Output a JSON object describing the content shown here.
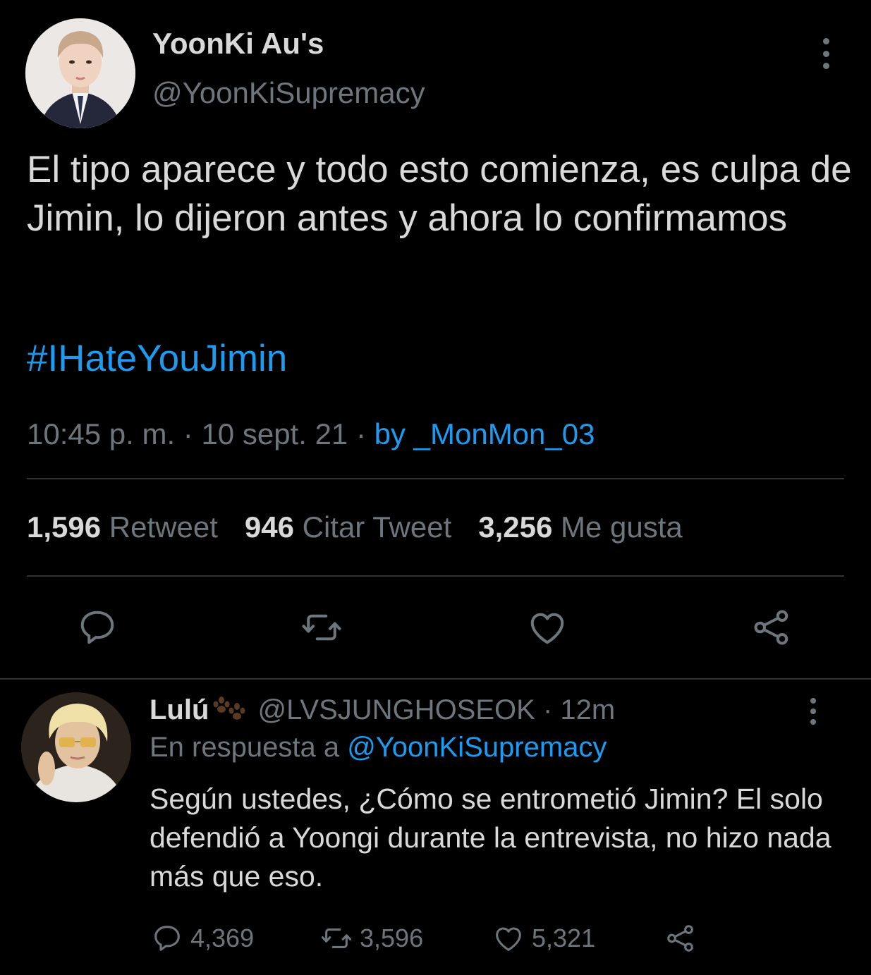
{
  "tweet": {
    "author_name": "YoonKi Au's",
    "author_handle": "@YoonKiSupremacy",
    "text": "El tipo aparece y todo esto comienza, es culpa de Jimin, lo dijeron antes y ahora lo confirmamos",
    "hashtag": "#IHateYouJimin",
    "time": "10:45 p. m.",
    "date": "10 sept. 21",
    "source": "by _MonMon_03",
    "separator": " · "
  },
  "stats": {
    "retweets_count": "1,596",
    "retweets_label": "Retweet",
    "quotes_count": "946",
    "quotes_label": "Citar Tweet",
    "likes_count": "3,256",
    "likes_label": "Me gusta"
  },
  "actions": {
    "icons": [
      "reply-icon",
      "retweet-icon",
      "like-icon",
      "share-icon"
    ]
  },
  "reply": {
    "author_name": "Lulú",
    "author_handle": "@LVSJUNGHOSEOK",
    "time_ago": "12m",
    "separator": " · ",
    "in_reply_prefix": "En respuesta a ",
    "in_reply_to": "@YoonKiSupremacy",
    "text": "Según ustedes, ¿Cómo se entrometió Jimin? El solo defendió a Yoongi durante la entrevista, no hizo nada más que eso.",
    "reply_count": "4,369",
    "retweet_count": "3,596",
    "like_count": "5,321"
  },
  "colors": {
    "background": "#000000",
    "text": "#d9d9d9",
    "muted": "#6e767d",
    "accent": "#1d9bf0",
    "divider": "#2f3336"
  }
}
